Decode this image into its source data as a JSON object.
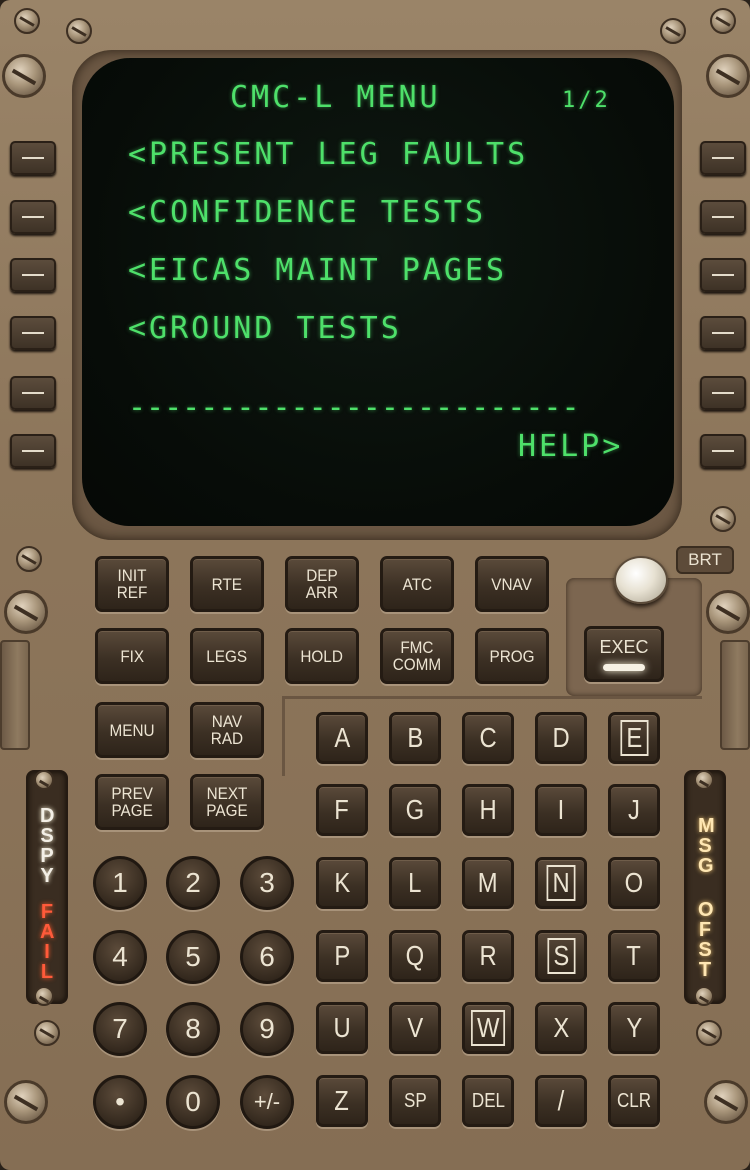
{
  "display": {
    "title": "CMC-L MENU",
    "page": "1/2",
    "lines": [
      "<PRESENT LEG FAULTS",
      "<CONFIDENCE TESTS",
      "<EICAS MAINT PAGES",
      "<GROUND TESTS"
    ],
    "separator": "-------------------------",
    "help": "HELP>",
    "text_color": "#4ee06a"
  },
  "function_keys": {
    "init_ref": "INIT\nREF",
    "rte": "RTE",
    "dep_arr": "DEP\nARR",
    "atc": "ATC",
    "vnav": "VNAV",
    "fix": "FIX",
    "legs": "LEGS",
    "hold": "HOLD",
    "fmc_comm": "FMC\nCOMM",
    "prog": "PROG",
    "menu": "MENU",
    "nav_rad": "NAV\nRAD",
    "prev_page": "PREV\nPAGE",
    "next_page": "NEXT\nPAGE",
    "exec": "EXEC"
  },
  "brightness_label": "BRT",
  "alpha_keys": [
    "A",
    "B",
    "C",
    "D",
    "E",
    "F",
    "G",
    "H",
    "I",
    "J",
    "K",
    "L",
    "M",
    "N",
    "O",
    "P",
    "Q",
    "R",
    "S",
    "T",
    "U",
    "V",
    "W",
    "X",
    "Y",
    "Z",
    "SP",
    "DEL",
    "/",
    "CLR"
  ],
  "numeric_keys": [
    "1",
    "2",
    "3",
    "4",
    "5",
    "6",
    "7",
    "8",
    "9",
    "•",
    "0",
    "+/-"
  ],
  "annunciators": {
    "dspy": "DSPY",
    "fail": "FAIL",
    "msg": "MSG",
    "ofst": "OFST"
  },
  "colors": {
    "panel": "#8d765b",
    "key": "#3c3024",
    "key_text": "#ece4d2",
    "fail_light": "#ff5a3a",
    "exec_light": "#f6f1e4"
  }
}
